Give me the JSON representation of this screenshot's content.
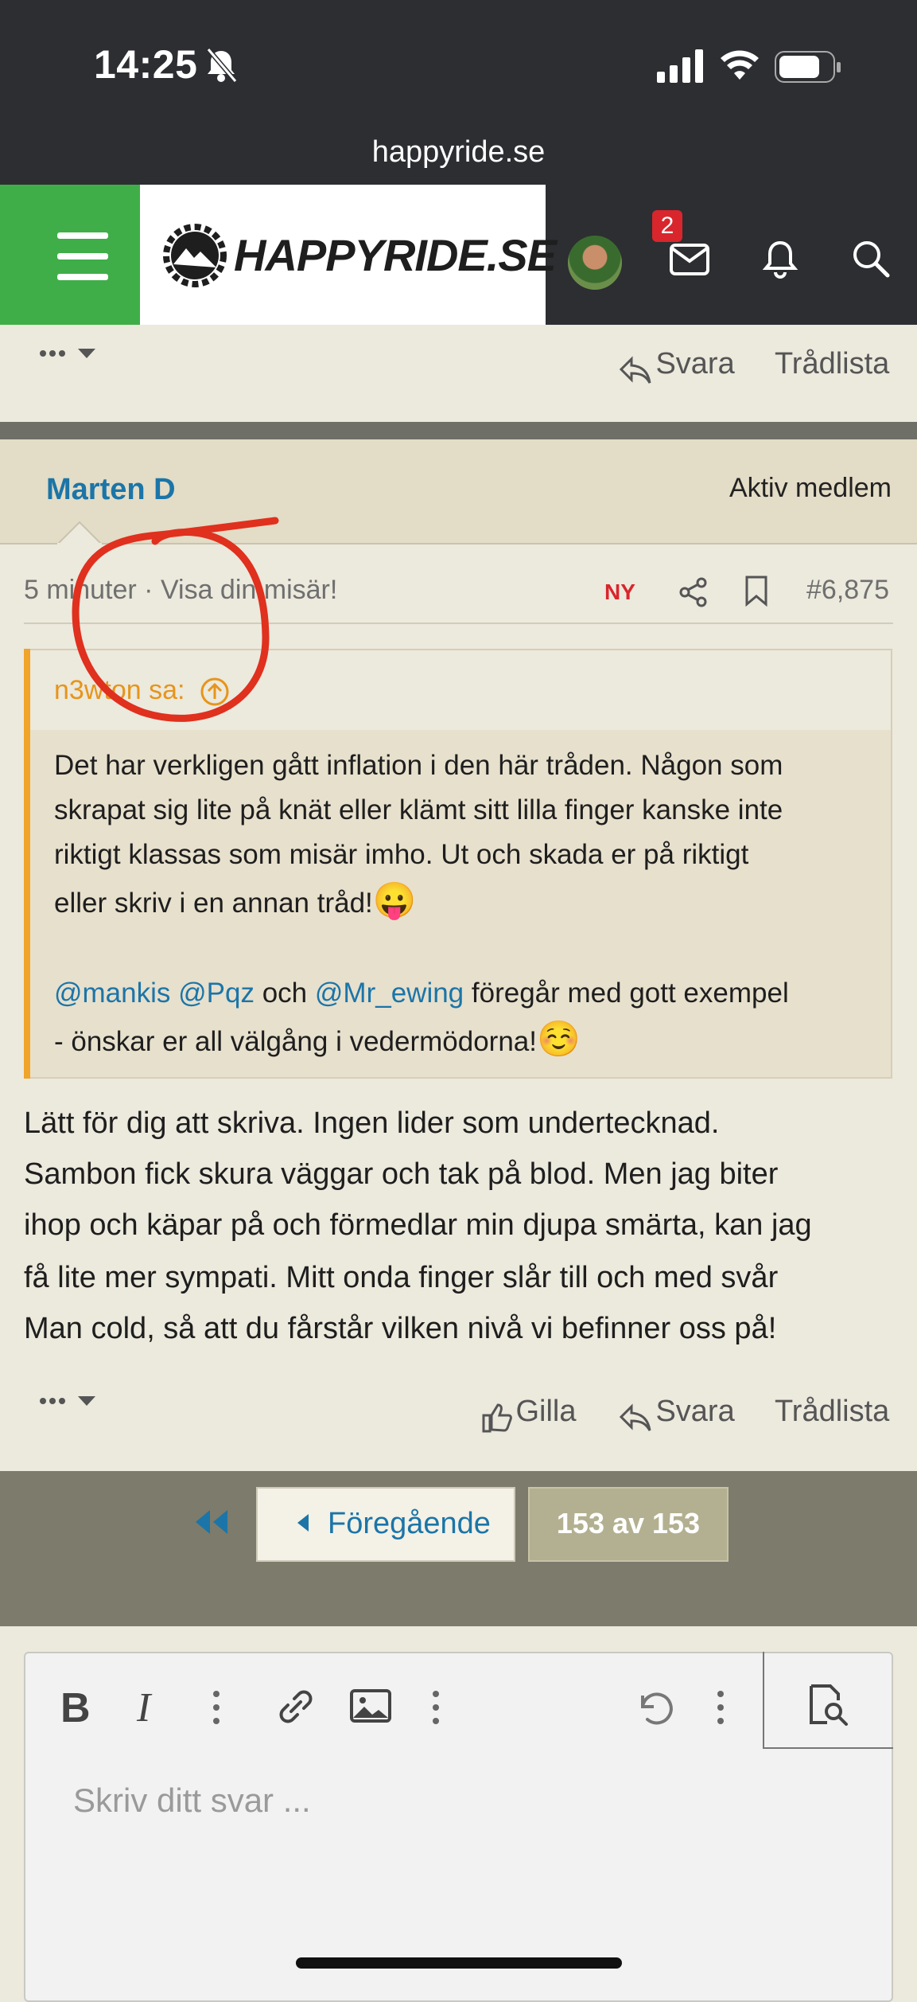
{
  "status_bar": {
    "time": "14:25",
    "url": "happyride.se"
  },
  "header": {
    "logo_text": "HAPPYRIDE.SE",
    "notification_count": "2"
  },
  "top_actions": {
    "reply": "Svara",
    "thread_list": "Trådlista"
  },
  "post": {
    "author": "Marten D",
    "role": "Aktiv medlem",
    "time_prefix": "5 minuter",
    "title_link": "Visa din misär!",
    "new_badge": "NY",
    "post_number": "#6,875",
    "quote": {
      "author": "n3wton sa:",
      "line1": "Det har verkligen gått inflation i den här tråden. Någon som",
      "line2": "skrapat sig lite på knät eller klämt sitt lilla finger kanske inte",
      "line3": "riktigt klassas som misär imho. Ut och skada er på riktigt",
      "line4": "eller skriv i en annan tråd!",
      "emoji1": "😛",
      "mention1": "@mankis",
      "mention2": "@Pqz",
      "och": "och",
      "mention3": "@Mr_ewing",
      "after_mentions": "föregår med gott exempel",
      "line6": "- önskar er all välgång i vedermödorna!",
      "emoji2": "☺️"
    },
    "body": {
      "line1": "Lätt för dig att skriva. Ingen lider som undertecknad.",
      "line2": "Sambon fick skura väggar och tak på blod. Men jag biter",
      "line3": "ihop och käpar på och förmedlar min djupa smärta, kan jag",
      "line4": "få lite mer sympati. Mitt onda finger slår till och med svår",
      "line5": "Man cold, så att du fårstår vilken nivå vi befinner oss på!"
    },
    "actions": {
      "like": "Gilla",
      "reply": "Svara",
      "thread_list": "Trådlista"
    }
  },
  "pagination": {
    "previous": "Föregående",
    "page": "153 av 153"
  },
  "editor": {
    "placeholder": "Skriv ditt svar ..."
  },
  "colors": {
    "accent_green": "#3fae49",
    "link_blue": "#1b75a8",
    "quote_orange": "#f0a42a",
    "annotation_red": "#e0301e"
  }
}
